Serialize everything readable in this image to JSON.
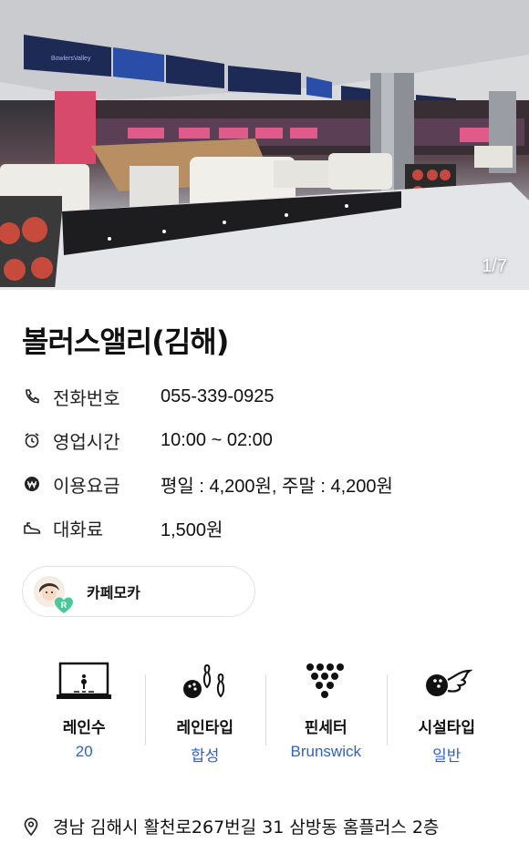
{
  "photo": {
    "counter": "1/7",
    "signage": "BowlersValley"
  },
  "venue": {
    "name": "볼러스앨리(김해)"
  },
  "info": [
    {
      "icon": "phone-icon",
      "label": "전화번호",
      "value": "055-339-0925"
    },
    {
      "icon": "alarm-clock-icon",
      "label": "영업시간",
      "value": "10:00 ~ 02:00"
    },
    {
      "icon": "won-icon",
      "label": "이용요금",
      "value": "평일 : 4,200원, 주말 : 4,200원"
    },
    {
      "icon": "shoe-icon",
      "label": "대화료",
      "value": "1,500원"
    }
  ],
  "profile": {
    "name": "카페모카",
    "badge": "R"
  },
  "stats": [
    {
      "icon": "lane-icon",
      "label": "레인수",
      "value": "20"
    },
    {
      "icon": "ball-pins-icon",
      "label": "레인타입",
      "value": "합성"
    },
    {
      "icon": "pinsetter-icon",
      "label": "핀세터",
      "value": "Brunswick"
    },
    {
      "icon": "facility-icon",
      "label": "시설타입",
      "value": "일반"
    }
  ],
  "address": {
    "icon": "location-pin-icon",
    "text": "경남 김해시 활천로267번길 31 삼방동 홈플러스 2층"
  },
  "colors": {
    "accent_blue": "#2d62c9",
    "badge_green": "#4cc79a"
  }
}
